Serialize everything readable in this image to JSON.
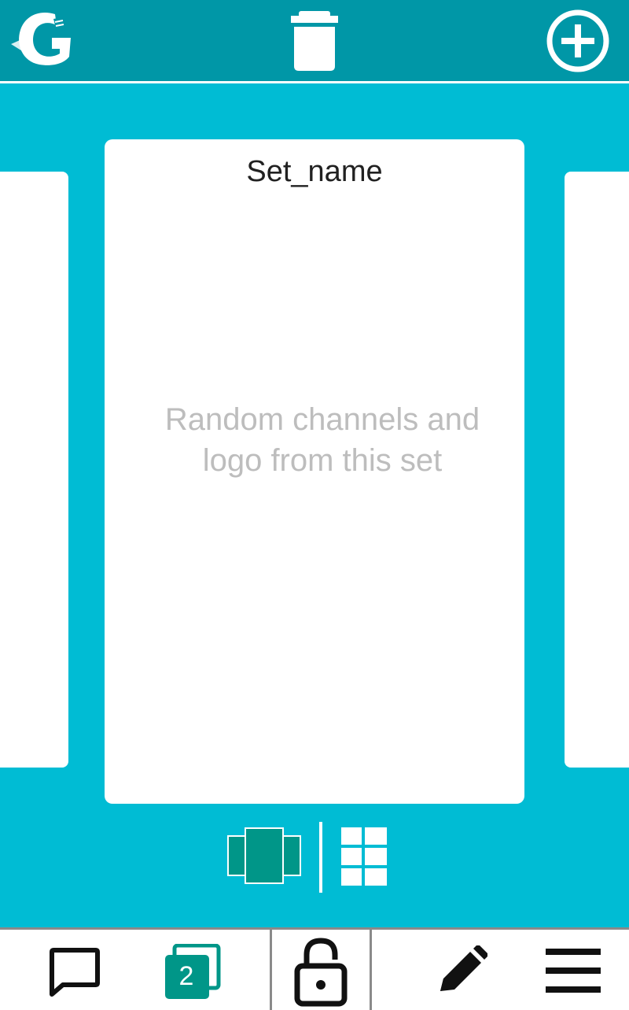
{
  "toolbar": {
    "logo_icon": "app-logo",
    "delete_icon": "trash-icon",
    "add_icon": "plus-circle-icon"
  },
  "card": {
    "title": "Set_name",
    "placeholder": "Random channels and logo from this set"
  },
  "view_toggle": {
    "carousel_icon": "carousel-view-icon",
    "grid_icon": "grid-view-icon",
    "active": "carousel"
  },
  "bottom_bar": {
    "chat_icon": "chat-icon",
    "sets_count": "2",
    "lock_icon": "lock-open-icon",
    "edit_icon": "pencil-icon",
    "menu_icon": "menu-icon"
  },
  "colors": {
    "toolbar": "#0097a7",
    "background": "#00bcd4",
    "accent_teal": "#009688",
    "card": "#ffffff",
    "placeholder_text": "#bdbdbd"
  }
}
